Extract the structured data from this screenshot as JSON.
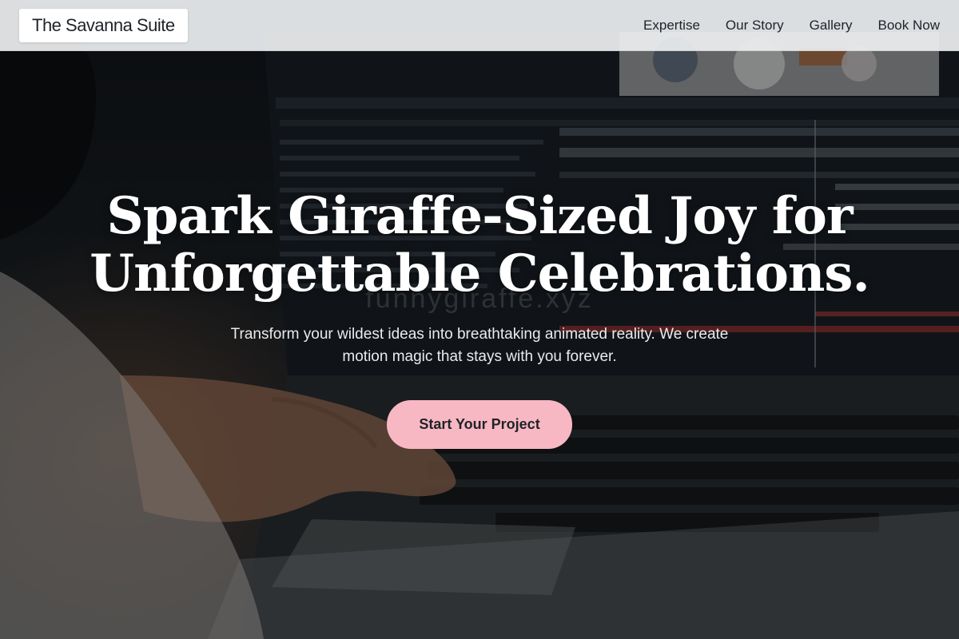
{
  "header": {
    "brand": "The Savanna Suite",
    "nav": [
      "Expertise",
      "Our Story",
      "Gallery",
      "Book Now"
    ]
  },
  "hero": {
    "title_line1": "Spark Giraffe-Sized Joy for",
    "title_line2": "Unforgettable Celebrations.",
    "subtitle": "Transform your wildest ideas into breathtaking animated reality. We create motion magic that stays with you forever.",
    "cta_label": "Start Your Project",
    "watermark": "funnygiraffe.xyz",
    "background_image": "laptop-motion-editor-photo"
  },
  "colors": {
    "cta_bg": "#f7b8c3",
    "header_bg": "#eceef0",
    "text_dark": "#1f2328",
    "text_light": "#ffffff"
  }
}
